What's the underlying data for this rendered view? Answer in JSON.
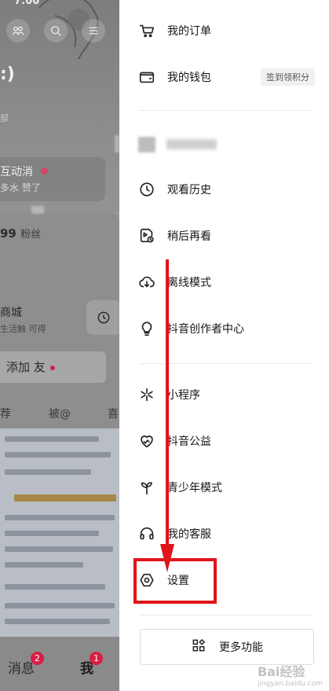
{
  "profile": {
    "status_time": "7:00",
    "nickname": ":)",
    "subtitle": "部",
    "interact_title": "互动消",
    "interact_sub": "多水 赞了",
    "fans": "99",
    "fans_unit": "粉丝",
    "shop_title": "商城",
    "shop_sub": "生活触 可得",
    "add_friend": "添加  友",
    "tabs": [
      "荐",
      "被@",
      "喜"
    ]
  },
  "bottom_nav": {
    "messages_label": "消息",
    "messages_badge": "2",
    "me_label": "我",
    "me_badge": "1"
  },
  "drawer": {
    "orders": "我的订单",
    "wallet": "我的钱包",
    "wallet_chip": "签到领积分",
    "history": "观看历史",
    "watch_later": "稍后再看",
    "offline": "离线模式",
    "creator": "抖音创作者中心",
    "mini_program": "小程序",
    "charity": "抖音公益",
    "teen_mode": "青少年模式",
    "customer_service": "我的客服",
    "settings": "设置",
    "more": "更多功能"
  },
  "annotation_colors": {
    "highlight": "#e0141a"
  },
  "watermark": {
    "text": "Bai经验",
    "sub": "jingyan.baidu.com"
  }
}
